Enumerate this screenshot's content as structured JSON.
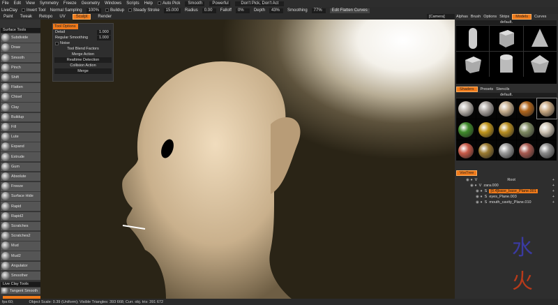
{
  "menu": [
    "File",
    "Edit",
    "View",
    "Symmetry",
    "Freeze",
    "Geometry",
    "Windows",
    "Scripts",
    "Help"
  ],
  "auto_pick": "Auto Pick",
  "smooth_mode": "Smooth",
  "power_mode": "Powerful",
  "pick_mode": "Don't Pick, Don't Act",
  "toolbar": {
    "liveclay": "LiveClay",
    "invert": "Invert Tool",
    "sampling_label": "Normal Sampling",
    "sampling": "100%",
    "buildup": "Buildup",
    "steady_label": "Steady Stroke",
    "steady": "15.000",
    "radius_label": "Radius",
    "radius": "0.00",
    "falloff_label": "Falloff",
    "falloff": "0%",
    "depth_label": "Depth",
    "depth": "43%",
    "smoothing_label": "Smoothing",
    "smoothing": "77%",
    "edit_curves": "Edit Flatten Curves",
    "camera": "[Camera]"
  },
  "room_tabs": [
    "Paint",
    "Tweak",
    "Retopo",
    "UV",
    "Sculpt",
    "Render"
  ],
  "active_room": "Sculpt",
  "sections": {
    "surface": "Surface Tools",
    "liveclay": "Live Clay Tools"
  },
  "tools": [
    "Subdivide",
    "Draw",
    "Smooth",
    "Pinch",
    "Shift",
    "Flatten",
    "Chisel",
    "Clay",
    "Buildup",
    "Fill",
    "Lute",
    "Expand",
    "Extrude",
    "Gum",
    "Absolute",
    "Freeze",
    "Surface Hide",
    "Rapid",
    "Rapid2",
    "Scratches",
    "Scratches2",
    "Mud",
    "Mud2",
    "Angulator",
    "Smoother"
  ],
  "liveclay_tools": [
    "Tangent Smooth"
  ],
  "tool_options": {
    "title": "Tool Options",
    "detail_label": "Detail",
    "detail": "1.000",
    "regsmooth_label": "Regular Smoothing",
    "regsmooth": "1.000",
    "noise": "Noise",
    "blend": "Tool Blend Factors",
    "merge_action": "Merge Action",
    "merge_value": "Realtime Detection",
    "collision_action": "Collision Action",
    "collision_value": "Merge"
  },
  "right_tabs": [
    "Alphas",
    "Brush",
    "Options",
    "Strips",
    "Models",
    "Curves"
  ],
  "models_preset": "default.",
  "shader_tabs": [
    "Shaders",
    "Presets",
    "Stencils"
  ],
  "shaders_preset": "default.",
  "shader_colors": [
    "#b9b3ad",
    "#aaa4a0",
    "#c8b090",
    "#b0651c",
    "#c8a882",
    "#3e8a2a",
    "#c0951c",
    "#b88e22",
    "#7e8a62",
    "#cfc5b5",
    "#c85a48",
    "#9a7a30",
    "#9a9a9a",
    "#a85a50",
    "#8a8a8a"
  ],
  "voxtree": {
    "tab": "VoxTree",
    "rows": [
      {
        "type": "V",
        "name": "Root"
      },
      {
        "type": "V",
        "name": "zara.000"
      },
      {
        "type": "S",
        "name": "[0.4]base_base_Plane.001",
        "selected": true
      },
      {
        "type": "S",
        "name": "eyes_Plane.003"
      },
      {
        "type": "S",
        "name": "mouth_cavity_Plane.010"
      }
    ]
  },
  "status": {
    "fps": "fps:60;",
    "info": "Object Scale: 0.39 (Uniform); Visible Triangles: 393 668; Curr. obj. tris: 391 672"
  }
}
